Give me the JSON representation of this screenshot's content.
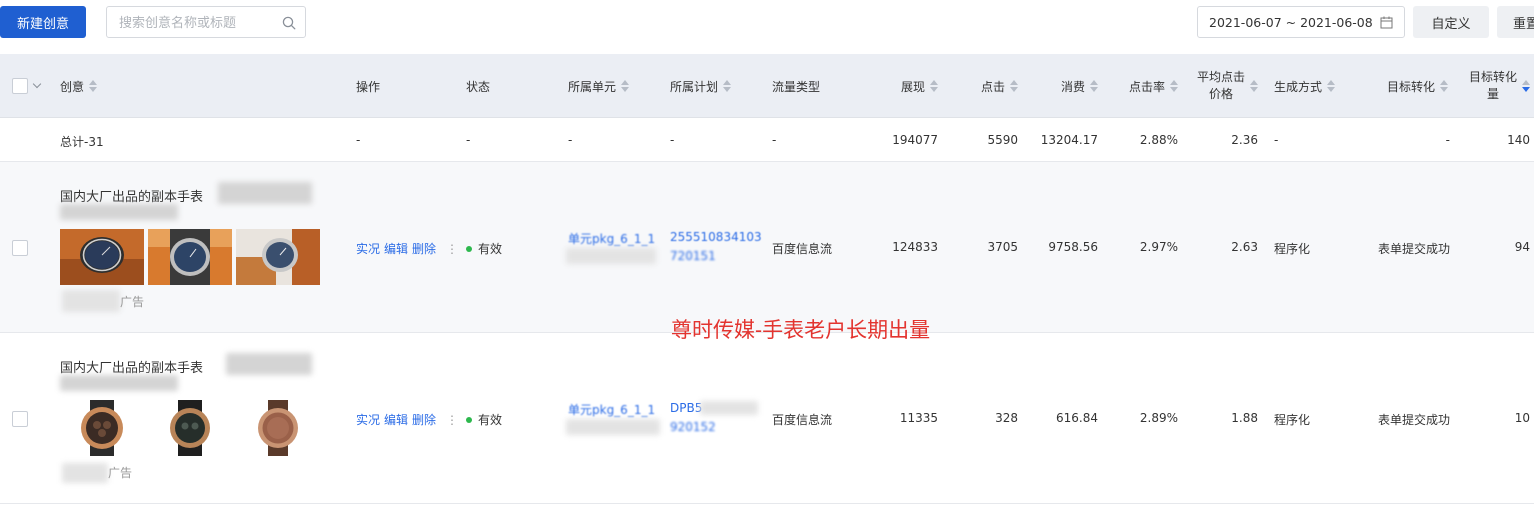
{
  "toolbar": {
    "new_button": "新建创意",
    "search_placeholder": "搜索创意名称或标题",
    "date_range": "2021-06-07 ~ 2021-06-08",
    "custom_button": "自定义",
    "reset_button": "重置"
  },
  "table": {
    "headers": {
      "creative": "创意",
      "operation": "操作",
      "status": "状态",
      "unit": "所属单元",
      "plan": "所属计划",
      "traffic": "流量类型",
      "impressions": "展现",
      "clicks": "点击",
      "cost": "消费",
      "ctr": "点击率",
      "avg_cpc_line1": "平均点击",
      "avg_cpc_line2": "价格",
      "gen_method": "生成方式",
      "target_conv": "目标转化",
      "target_conv_count_line1": "目标转化",
      "target_conv_count_line2": "量"
    },
    "total": {
      "label": "总计-31",
      "operation": "-",
      "status": "-",
      "unit": "-",
      "plan": "-",
      "traffic": "-",
      "impressions": "194077",
      "clicks": "5590",
      "cost": "13204.17",
      "ctr": "2.88%",
      "avg_cpc": "2.36",
      "gen_method": "-",
      "target_conv": "-",
      "target_conv_count": "140"
    },
    "rows": [
      {
        "title": "国内大厂出品的副本手表",
        "ad_label": "广告",
        "ops": [
          "实况",
          "编辑",
          "删除"
        ],
        "more": "⋮",
        "status": "有效",
        "unit": "单元pkg_6_1_1",
        "plan_line1": "255510834103",
        "plan_line2": "720151",
        "traffic": "百度信息流",
        "impressions": "124833",
        "clicks": "3705",
        "cost": "9758.56",
        "ctr": "2.97%",
        "avg_cpc": "2.63",
        "gen_method": "程序化",
        "target_conv": "表单提交成功",
        "target_conv_count": "94"
      },
      {
        "title": "国内大厂出品的副本手表",
        "ad_label": "广告",
        "ops": [
          "实况",
          "编辑",
          "删除"
        ],
        "more": "⋮",
        "status": "有效",
        "unit": "单元pkg_6_1_1",
        "plan_line1": "DPB5",
        "plan_line2": "920152",
        "traffic": "百度信息流",
        "impressions": "11335",
        "clicks": "328",
        "cost": "616.84",
        "ctr": "2.89%",
        "avg_cpc": "1.88",
        "gen_method": "程序化",
        "target_conv": "表单提交成功",
        "target_conv_count": "10"
      }
    ]
  },
  "watermark": "尊时传媒-手表老户长期出量",
  "colors": {
    "primary": "#1f5fd1",
    "link": "#2a6be6",
    "status_active": "#2db84d",
    "header_bg": "#ebeef4",
    "watermark": "#e3342f"
  }
}
